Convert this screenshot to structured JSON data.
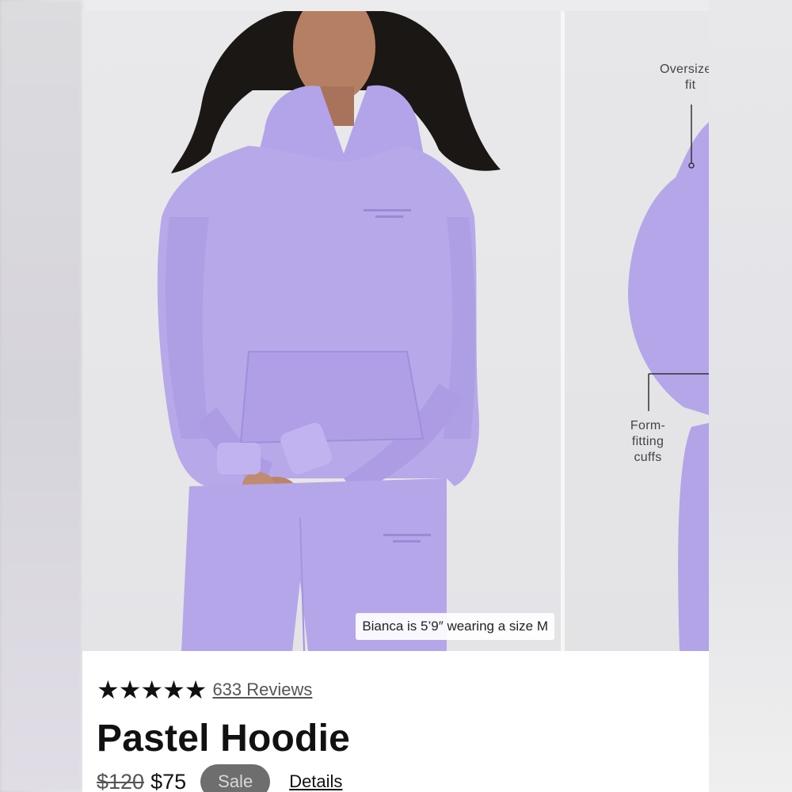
{
  "gallery": {
    "caption": "Bianca is 5’9″ wearing a size M",
    "callouts": {
      "fit_line1": "Oversize",
      "fit_line2": "fit",
      "cuffs_line1": "Form-",
      "cuffs_line2": "fitting",
      "cuffs_line3": "cuffs"
    },
    "garment_color": "#b7a8ea",
    "active_slide": 1
  },
  "product": {
    "rating_stars": "★★★★★",
    "reviews_label": "633 Reviews",
    "title": "Pastel Hoodie",
    "original_price": "$120",
    "sale_price": "$75",
    "sale_badge": "Sale",
    "details_label": "Details"
  },
  "colors": {
    "text_primary": "#111111",
    "badge_bg": "#6e6e6e",
    "garment": "#b7a8ea"
  }
}
